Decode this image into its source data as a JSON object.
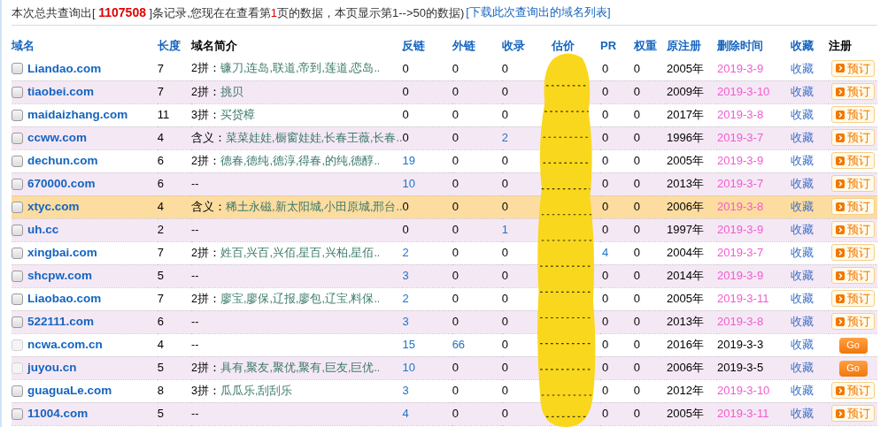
{
  "summary": {
    "before": "本次总共查询出[ ",
    "count": "1107508",
    "middle": " ]条记录,您现在在查看第",
    "page": "1",
    "after": "页的数据，本页显示第1-->50的数据) ",
    "link": "[下载此次查询出的域名列表]"
  },
  "columns": [
    {
      "label": "域名",
      "sortable": true
    },
    {
      "label": "长度",
      "sortable": true
    },
    {
      "label": "域名简介",
      "sortable": false
    },
    {
      "label": "反链",
      "sortable": true
    },
    {
      "label": "外链",
      "sortable": true
    },
    {
      "label": "收录",
      "sortable": true
    },
    {
      "label": "估价",
      "sortable": true
    },
    {
      "label": "PR",
      "sortable": true
    },
    {
      "label": "权重",
      "sortable": true
    },
    {
      "label": "原注册",
      "sortable": true
    },
    {
      "label": "删除时间",
      "sortable": true
    },
    {
      "label": "收藏",
      "sortable": true
    },
    {
      "label": "注册",
      "sortable": false
    }
  ],
  "rows": [
    {
      "domain": "Liandao.com",
      "checked": false,
      "disabled": false,
      "highlighted": false,
      "length": "7",
      "intro_prefix": "2拼：",
      "intro": "镰刀,连岛,联道,帝到,莲道,恋岛..",
      "backlinks": {
        "text": "0",
        "link": false
      },
      "outlinks": {
        "text": "0",
        "link": false
      },
      "indexed": {
        "text": "0",
        "link": false
      },
      "pr": {
        "text": "0",
        "link": false
      },
      "weight": "0",
      "registered": "2005年",
      "deleted": "2019-3-9",
      "favorite": "收藏",
      "register": {
        "kind": "reserve",
        "label": "预订"
      }
    },
    {
      "domain": "tiaobei.com",
      "checked": false,
      "disabled": false,
      "highlighted": false,
      "length": "7",
      "intro_prefix": "2拼：",
      "intro": "挑贝",
      "backlinks": {
        "text": "0",
        "link": false
      },
      "outlinks": {
        "text": "0",
        "link": false
      },
      "indexed": {
        "text": "0",
        "link": false
      },
      "pr": {
        "text": "0",
        "link": false
      },
      "weight": "0",
      "registered": "2009年",
      "deleted": "2019-3-10",
      "favorite": "收藏",
      "register": {
        "kind": "reserve",
        "label": "预订"
      }
    },
    {
      "domain": "maidaizhang.com",
      "checked": false,
      "disabled": false,
      "highlighted": false,
      "length": "11",
      "intro_prefix": "3拼：",
      "intro": "买贷樟",
      "backlinks": {
        "text": "0",
        "link": false
      },
      "outlinks": {
        "text": "0",
        "link": false
      },
      "indexed": {
        "text": "0",
        "link": false
      },
      "pr": {
        "text": "0",
        "link": false
      },
      "weight": "0",
      "registered": "2017年",
      "deleted": "2019-3-8",
      "favorite": "收藏",
      "register": {
        "kind": "reserve",
        "label": "预订"
      }
    },
    {
      "domain": "ccww.com",
      "checked": false,
      "disabled": false,
      "highlighted": false,
      "length": "4",
      "intro_prefix": "含义：",
      "intro": "菜菜娃娃,橱窗娃娃,长春王薇,长春..",
      "backlinks": {
        "text": "0",
        "link": false
      },
      "outlinks": {
        "text": "0",
        "link": false
      },
      "indexed": {
        "text": "2",
        "link": true
      },
      "pr": {
        "text": "0",
        "link": false
      },
      "weight": "0",
      "registered": "1996年",
      "deleted": "2019-3-7",
      "favorite": "收藏",
      "register": {
        "kind": "reserve",
        "label": "预订"
      }
    },
    {
      "domain": "dechun.com",
      "checked": false,
      "disabled": false,
      "highlighted": false,
      "length": "6",
      "intro_prefix": "2拼：",
      "intro": "德春,德纯,德淳,得春,的纯,德醇..",
      "backlinks": {
        "text": "19",
        "link": true
      },
      "outlinks": {
        "text": "0",
        "link": false
      },
      "indexed": {
        "text": "0",
        "link": false
      },
      "pr": {
        "text": "0",
        "link": false
      },
      "weight": "0",
      "registered": "2005年",
      "deleted": "2019-3-9",
      "favorite": "收藏",
      "register": {
        "kind": "reserve",
        "label": "预订"
      }
    },
    {
      "domain": "670000.com",
      "checked": false,
      "disabled": false,
      "highlighted": false,
      "length": "6",
      "intro": "--",
      "backlinks": {
        "text": "10",
        "link": true
      },
      "outlinks": {
        "text": "0",
        "link": false
      },
      "indexed": {
        "text": "0",
        "link": false
      },
      "pr": {
        "text": "0",
        "link": false
      },
      "weight": "0",
      "registered": "2013年",
      "deleted": "2019-3-7",
      "favorite": "收藏",
      "register": {
        "kind": "reserve",
        "label": "预订"
      }
    },
    {
      "domain": "xtyc.com",
      "checked": false,
      "disabled": false,
      "highlighted": true,
      "length": "4",
      "intro_prefix": "含义：",
      "intro": "稀土永磁,新太阳城,小田原城,邢台..",
      "backlinks": {
        "text": "0",
        "link": false
      },
      "outlinks": {
        "text": "0",
        "link": false
      },
      "indexed": {
        "text": "0",
        "link": false
      },
      "pr": {
        "text": "0",
        "link": false
      },
      "weight": "0",
      "registered": "2006年",
      "deleted": "2019-3-8",
      "favorite": "收藏",
      "register": {
        "kind": "reserve",
        "label": "预订"
      }
    },
    {
      "domain": "uh.cc",
      "checked": false,
      "disabled": false,
      "highlighted": false,
      "length": "2",
      "intro": "--",
      "backlinks": {
        "text": "0",
        "link": false
      },
      "outlinks": {
        "text": "0",
        "link": false
      },
      "indexed": {
        "text": "1",
        "link": true
      },
      "pr": {
        "text": "0",
        "link": false
      },
      "weight": "0",
      "registered": "1997年",
      "deleted": "2019-3-9",
      "favorite": "收藏",
      "register": {
        "kind": "reserve",
        "label": "预订"
      }
    },
    {
      "domain": "xingbai.com",
      "checked": false,
      "disabled": false,
      "highlighted": false,
      "length": "7",
      "intro_prefix": "2拼：",
      "intro": "姓百,兴百,兴佰,星百,兴柏,星佰..",
      "backlinks": {
        "text": "2",
        "link": true
      },
      "outlinks": {
        "text": "0",
        "link": false
      },
      "indexed": {
        "text": "0",
        "link": false
      },
      "pr": {
        "text": "4",
        "link": true
      },
      "weight": "0",
      "registered": "2004年",
      "deleted": "2019-3-7",
      "favorite": "收藏",
      "register": {
        "kind": "reserve",
        "label": "预订"
      }
    },
    {
      "domain": "shcpw.com",
      "checked": false,
      "disabled": false,
      "highlighted": false,
      "length": "5",
      "intro": "--",
      "backlinks": {
        "text": "3",
        "link": true
      },
      "outlinks": {
        "text": "0",
        "link": false
      },
      "indexed": {
        "text": "0",
        "link": false
      },
      "pr": {
        "text": "0",
        "link": false
      },
      "weight": "0",
      "registered": "2014年",
      "deleted": "2019-3-9",
      "favorite": "收藏",
      "register": {
        "kind": "reserve",
        "label": "预订"
      }
    },
    {
      "domain": "Liaobao.com",
      "checked": false,
      "disabled": false,
      "highlighted": false,
      "length": "7",
      "intro_prefix": "2拼：",
      "intro": "廖宝,廖保,辽报,廖包,辽宝,料保..",
      "backlinks": {
        "text": "2",
        "link": true
      },
      "outlinks": {
        "text": "0",
        "link": false
      },
      "indexed": {
        "text": "0",
        "link": false
      },
      "pr": {
        "text": "0",
        "link": false
      },
      "weight": "0",
      "registered": "2005年",
      "deleted": "2019-3-11",
      "favorite": "收藏",
      "register": {
        "kind": "reserve",
        "label": "预订"
      }
    },
    {
      "domain": "522111.com",
      "checked": false,
      "disabled": false,
      "highlighted": false,
      "length": "6",
      "intro": "--",
      "backlinks": {
        "text": "3",
        "link": true
      },
      "outlinks": {
        "text": "0",
        "link": false
      },
      "indexed": {
        "text": "0",
        "link": false
      },
      "pr": {
        "text": "0",
        "link": false
      },
      "weight": "0",
      "registered": "2013年",
      "deleted": "2019-3-8",
      "favorite": "收藏",
      "register": {
        "kind": "reserve",
        "label": "预订"
      }
    },
    {
      "domain": "ncwa.com.cn",
      "checked": false,
      "disabled": true,
      "highlighted": false,
      "length": "4",
      "intro": "--",
      "backlinks": {
        "text": "15",
        "link": true
      },
      "outlinks": {
        "text": "66",
        "link": true
      },
      "indexed": {
        "text": "0",
        "link": false
      },
      "pr": {
        "text": "0",
        "link": false
      },
      "weight": "0",
      "registered": "2016年",
      "deleted": "2019-3-3",
      "favorite": "收藏",
      "register": {
        "kind": "go",
        "label": "Go"
      }
    },
    {
      "domain": "juyou.cn",
      "checked": false,
      "disabled": true,
      "highlighted": false,
      "length": "5",
      "intro_prefix": "2拼：",
      "intro": "具有,聚友,聚优,聚有,巨友,巨优..",
      "backlinks": {
        "text": "10",
        "link": true
      },
      "outlinks": {
        "text": "0",
        "link": false
      },
      "indexed": {
        "text": "0",
        "link": false
      },
      "pr": {
        "text": "0",
        "link": false
      },
      "weight": "0",
      "registered": "2006年",
      "deleted": "2019-3-5",
      "favorite": "收藏",
      "register": {
        "kind": "go",
        "label": "Go"
      }
    },
    {
      "domain": "guaguaLe.com",
      "checked": false,
      "disabled": false,
      "highlighted": false,
      "length": "8",
      "intro_prefix": "3拼：",
      "intro": "瓜瓜乐,刮刮乐",
      "backlinks": {
        "text": "3",
        "link": true
      },
      "outlinks": {
        "text": "0",
        "link": false
      },
      "indexed": {
        "text": "0",
        "link": false
      },
      "pr": {
        "text": "0",
        "link": false
      },
      "weight": "0",
      "registered": "2012年",
      "deleted": "2019-3-10",
      "favorite": "收藏",
      "register": {
        "kind": "reserve",
        "label": "预订"
      }
    },
    {
      "domain": "11004.com",
      "checked": false,
      "disabled": false,
      "highlighted": false,
      "length": "5",
      "intro": "--",
      "backlinks": {
        "text": "4",
        "link": true
      },
      "outlinks": {
        "text": "0",
        "link": false
      },
      "indexed": {
        "text": "0",
        "link": false
      },
      "pr": {
        "text": "0",
        "link": false
      },
      "weight": "0",
      "registered": "2005年",
      "deleted": "2019-3-11",
      "favorite": "收藏",
      "register": {
        "kind": "reserve",
        "label": "预订"
      }
    }
  ]
}
